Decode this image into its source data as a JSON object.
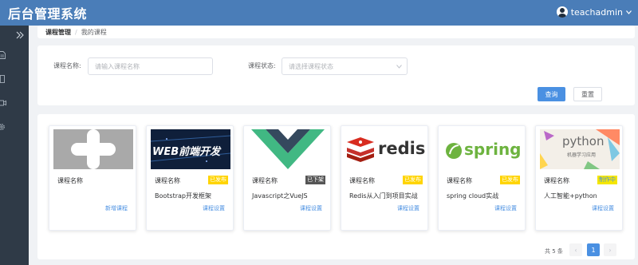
{
  "header": {
    "title": "后台管理系统",
    "username": "teachadmin"
  },
  "sidebar": {
    "icons": [
      "expand-icon",
      "document-icon",
      "book-icon",
      "video-icon",
      "settings-icon"
    ]
  },
  "breadcrumb": {
    "root": "课程管理",
    "separator": "/",
    "current": "我的课程"
  },
  "search": {
    "name_label": "课程名称:",
    "name_placeholder": "请输入课程名称",
    "status_label": "课程状态:",
    "status_placeholder": "请选择课程状态",
    "search_button": "查询",
    "reset_button": "重置"
  },
  "cards": [
    {
      "label": "课程名称",
      "name": "",
      "status": "",
      "link": "新增课程",
      "thumb": "add-course"
    },
    {
      "label": "课程名称",
      "name": "Bootstrap开发框架",
      "status": "已发布",
      "status_color": "#ffd400",
      "link": "课程设置",
      "thumb": "web",
      "thumb_text": "WEB前端开发"
    },
    {
      "label": "课程名称",
      "name": "Javascript之VueJS",
      "status": "已下架",
      "status_color": "#555555",
      "link": "课程设置",
      "thumb": "vue"
    },
    {
      "label": "课程名称",
      "name": "Redis从入门到项目实战",
      "status": "已发布",
      "status_color": "#ffd400",
      "link": "课程设置",
      "thumb": "redis",
      "thumb_text": "redis"
    },
    {
      "label": "课程名称",
      "name": "spring cloud实战",
      "status": "已发布",
      "status_color": "#ffd400",
      "link": "课程设置",
      "thumb": "spring",
      "thumb_text": "spring"
    },
    {
      "label": "课程名称",
      "name": "人工智能+python",
      "status": "制作中",
      "status_color": "#f5e600",
      "link": "课程设置",
      "thumb": "python",
      "thumb_text": "python",
      "thumb_subtext": "机器学习应用"
    }
  ],
  "pagination": {
    "total": "共 5 条",
    "prev": "‹",
    "page": "1",
    "next": "›"
  }
}
